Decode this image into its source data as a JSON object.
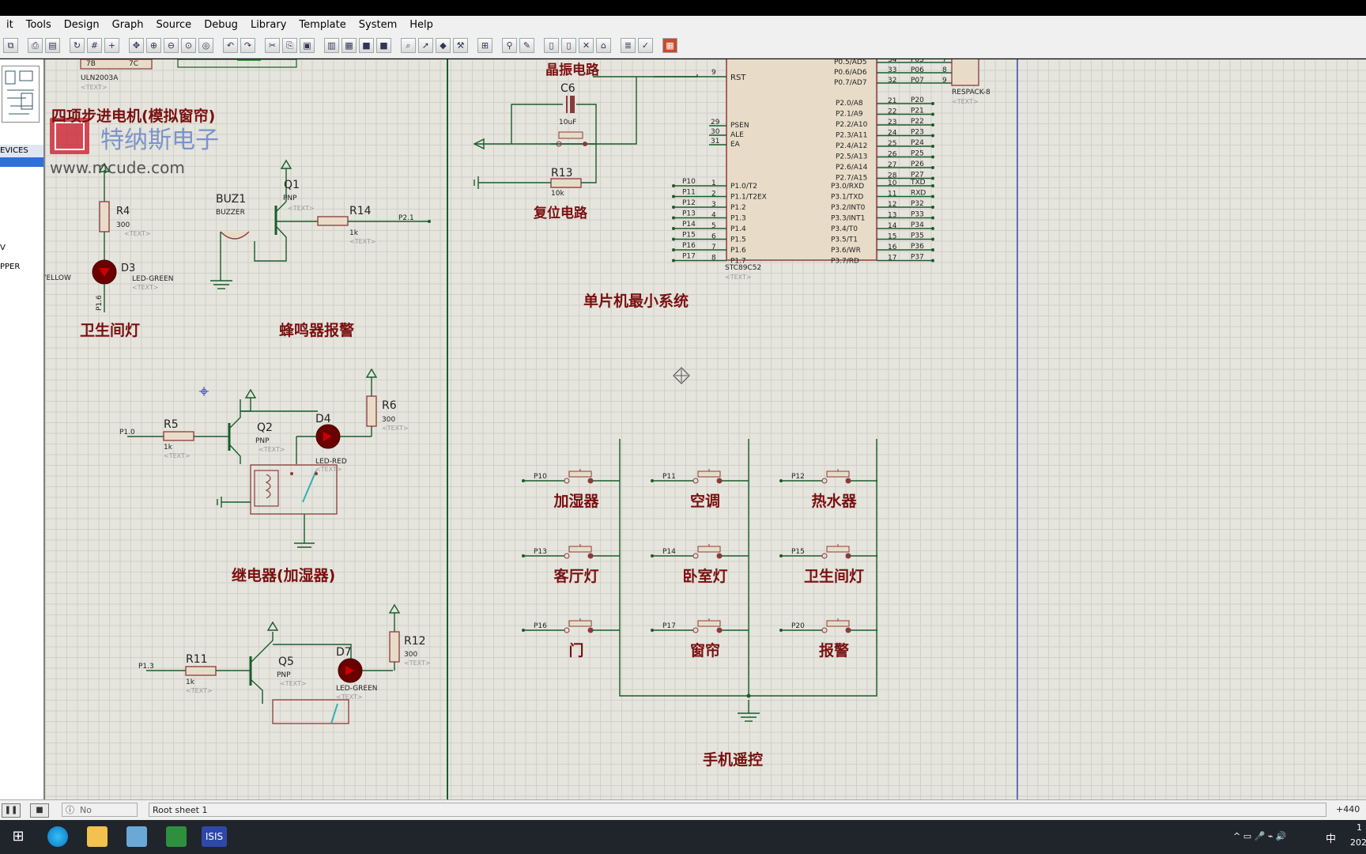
{
  "menu": [
    "it",
    "Tools",
    "Design",
    "Graph",
    "Source",
    "Debug",
    "Library",
    "Template",
    "System",
    "Help"
  ],
  "left_panel": {
    "header": "EVICES",
    "items": [
      "V",
      "PPER"
    ]
  },
  "schematic": {
    "watermark": {
      "brand": "特纳斯电子",
      "url": "www.mcude.com"
    },
    "sections": {
      "stepper": "四项步进电机(模拟窗帘)",
      "crystal": "晶振电路",
      "reset": "复位电路",
      "mcu_min": "单片机最小系统",
      "bath_light": "卫生间灯",
      "buzzer_alarm": "蜂鸣器报警",
      "relay_humidifier": "继电器(加湿器)",
      "remote": "手机遥控"
    },
    "uln": {
      "name": "ULN2003A",
      "pin_a": "7B",
      "pin_b": "7C",
      "text": "<TEXT>"
    },
    "respack": {
      "name": "RESPACK-8",
      "text": "<TEXT>"
    },
    "text_tag": "<TEXT>",
    "c6": {
      "ref": "C6",
      "value": "10uF"
    },
    "r13": {
      "ref": "R13",
      "value": "10k"
    },
    "r4": {
      "ref": "R4",
      "value": "300"
    },
    "d3": {
      "ref": "D3",
      "value": "LED-GREEN",
      "net": "P1.6"
    },
    "yellow": "YELLOW",
    "buz1": {
      "ref": "BUZ1",
      "value": "BUZZER"
    },
    "q1": {
      "ref": "Q1",
      "value": "PNP"
    },
    "r14": {
      "ref": "R14",
      "value": "1k",
      "net": "P2.1"
    },
    "q2": {
      "ref": "Q2",
      "value": "PNP"
    },
    "r5": {
      "ref": "R5",
      "value": "1k",
      "net": "P1.0"
    },
    "d4": {
      "ref": "D4",
      "value": "LED-RED"
    },
    "r6": {
      "ref": "R6",
      "value": "300"
    },
    "q5": {
      "ref": "Q5",
      "value": "PNP"
    },
    "r11": {
      "ref": "R11",
      "value": "1k",
      "net": "P1.3"
    },
    "d7": {
      "ref": "D7",
      "value": "LED-GREEN"
    },
    "r12": {
      "ref": "R12",
      "value": "300"
    },
    "mcu": {
      "name": "STC89C52",
      "rst": "RST",
      "rst_pin": "9",
      "left_ctrl": [
        [
          "29",
          "PSEN"
        ],
        [
          "30",
          "ALE"
        ],
        [
          "31",
          "EA"
        ]
      ],
      "p1_pins": [
        [
          "P10",
          "1",
          "P1.0/T2"
        ],
        [
          "P11",
          "2",
          "P1.1/T2EX"
        ],
        [
          "P12",
          "3",
          "P1.2"
        ],
        [
          "P13",
          "4",
          "P1.3"
        ],
        [
          "P14",
          "5",
          "P1.4"
        ],
        [
          "P15",
          "6",
          "P1.5"
        ],
        [
          "P16",
          "7",
          "P1.6"
        ],
        [
          "P17",
          "8",
          "P1.7"
        ]
      ],
      "p0_pins": [
        [
          "P0.5/AD5",
          "34",
          "P05",
          "7"
        ],
        [
          "P0.6/AD6",
          "33",
          "P06",
          "8"
        ],
        [
          "P0.7/AD7",
          "32",
          "P07",
          "9"
        ]
      ],
      "p2_pins": [
        [
          "P2.0/A8",
          "21",
          "P20"
        ],
        [
          "P2.1/A9",
          "22",
          "P21"
        ],
        [
          "P2.2/A10",
          "23",
          "P22"
        ],
        [
          "P2.3/A11",
          "24",
          "P23"
        ],
        [
          "P2.4/A12",
          "25",
          "P24"
        ],
        [
          "P2.5/A13",
          "26",
          "P25"
        ],
        [
          "P2.6/A14",
          "27",
          "P26"
        ],
        [
          "P2.7/A15",
          "28",
          "P27"
        ]
      ],
      "p3_pins": [
        [
          "P3.0/RXD",
          "10",
          "TXD"
        ],
        [
          "P3.1/TXD",
          "11",
          "RXD"
        ],
        [
          "P3.2/INT0",
          "12",
          "P32"
        ],
        [
          "P3.3/INT1",
          "13",
          "P33"
        ],
        [
          "P3.4/T0",
          "14",
          "P34"
        ],
        [
          "P3.5/T1",
          "15",
          "P35"
        ],
        [
          "P3.6/WR",
          "16",
          "P36"
        ],
        [
          "P3.7/RD",
          "17",
          "P37"
        ]
      ]
    },
    "buttons": [
      {
        "net": "P10",
        "label": "加湿器"
      },
      {
        "net": "P11",
        "label": "空调"
      },
      {
        "net": "P12",
        "label": "热水器"
      },
      {
        "net": "P13",
        "label": "客厅灯"
      },
      {
        "net": "P14",
        "label": "卧室灯"
      },
      {
        "net": "P15",
        "label": "卫生间灯"
      },
      {
        "net": "P16",
        "label": "门"
      },
      {
        "net": "P17",
        "label": "窗帘"
      },
      {
        "net": "P20",
        "label": "报警"
      }
    ]
  },
  "status": {
    "messages": "No Messages",
    "sheet": "Root sheet 1",
    "coord": "+440"
  },
  "taskbar": {
    "isis": "ISIS",
    "ime": "中",
    "clock": "1",
    "year": "202"
  }
}
